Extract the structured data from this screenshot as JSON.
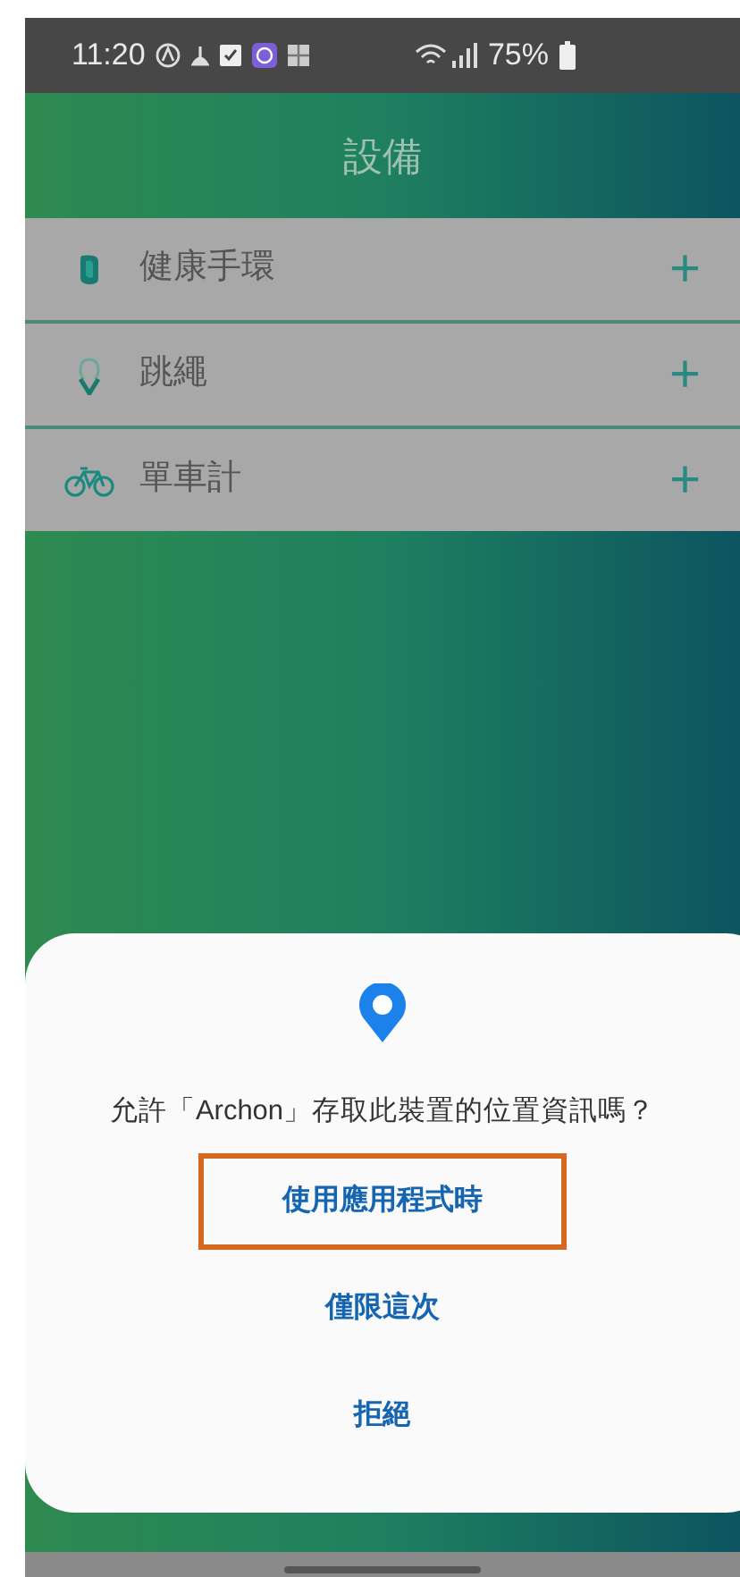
{
  "status_bar": {
    "time": "11:20",
    "battery": "75%"
  },
  "header": {
    "title": "設備"
  },
  "devices": [
    {
      "kind": "band",
      "name": "健康手環",
      "action": "+"
    },
    {
      "kind": "rope",
      "name": "跳繩",
      "action": "+"
    },
    {
      "kind": "bike",
      "name": "單車計",
      "action": "+"
    }
  ],
  "dialog": {
    "message": "允許「Archon」存取此裝置的位置資訊嗎？",
    "options": [
      {
        "label": "使用應用程式時",
        "highlighted": true
      },
      {
        "label": "僅限這次",
        "highlighted": false
      },
      {
        "label": "拒絕",
        "highlighted": false
      }
    ]
  }
}
